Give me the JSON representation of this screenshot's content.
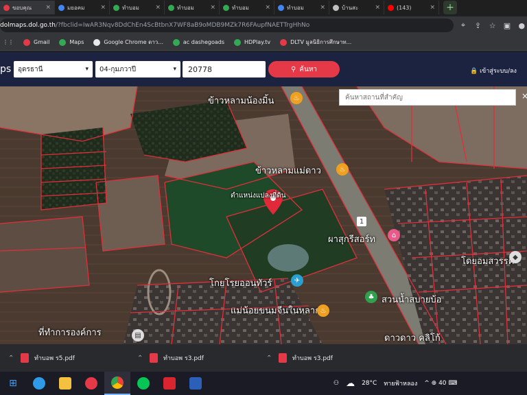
{
  "browser": {
    "tabs": [
      {
        "title": "ขอบคุณ",
        "favicon_color": "#e53948",
        "favicon_icon": "location-pin-icon"
      },
      {
        "title": "มยอคม",
        "favicon_color": "#4285f4",
        "favicon_icon": "google-drive-icon"
      },
      {
        "title": "ทำบอม",
        "favicon_color": "#34a853",
        "favicon_icon": "green-circle-icon"
      },
      {
        "title": "ทำบอม",
        "favicon_color": "#34a853",
        "favicon_icon": "green-circle-icon"
      },
      {
        "title": "ทำบอม",
        "favicon_color": "#34a853",
        "favicon_icon": "green-circle-icon"
      },
      {
        "title": "ทำบอม",
        "favicon_color": "#4285f4",
        "favicon_icon": "docs-icon"
      },
      {
        "title": "บ้านสะ",
        "favicon_color": "#c0c0c0",
        "favicon_icon": "globe-icon"
      },
      {
        "title": "(143)",
        "favicon_color": "#ff0000",
        "favicon_icon": "youtube-icon"
      }
    ],
    "tab_close": "×",
    "new_tab": "+",
    "url_host": "dolmaps.dol.go.th",
    "url_rest": "/?fbclid=IwAR3Nqv8DdChEn4ScBtbnX7WF8aB9oMDB9MZk7R6FAupfNAETTrgHhNo",
    "bookmarks": [
      {
        "label": "Gmail",
        "color": "#e53948"
      },
      {
        "label": "Maps",
        "color": "#34a853"
      },
      {
        "label": "Google Chrome ดาว...",
        "color": "#e8e8e8"
      },
      {
        "label": "ac dashegoads",
        "color": "#34a853"
      },
      {
        "label": "HDPlay.tv",
        "color": "#34a853"
      },
      {
        "label": "DLTV มูลนิธิการศึกษาท...",
        "color": "#e53948"
      }
    ]
  },
  "app": {
    "brand": "ps",
    "province": "อุดรธานี",
    "district": "04-กุมภวาปี",
    "parcel_number": "20778",
    "search_label": "ค้นหา",
    "login_label": "เข้าสู่ระบบ/ลง",
    "accent_color": "#e53948",
    "header_color": "#1c2340"
  },
  "map": {
    "poi_search_placeholder": "ค้นหาสถานที่สำคัญ",
    "close": "×",
    "labels": {
      "rice_top": "ข้าวหลามน้องมิ้น",
      "rice_mid": "ข้าวหลามแม่ดาว",
      "parcel_position": "ตำแหน่งแปลงที่ดิน",
      "phasuk": "ผาสุกรีสอร์ท",
      "toyrai": "โกยโรยออนทัวร์",
      "nong": "แม่น้อยขนมจีนในหลาก",
      "sawan": "สวนน้ำสบายบ้อ",
      "chon": "โดยอมสวรรค์",
      "office": "ที่ทำการองค์การ",
      "khaodao": "ดาวดาว คลิโก้"
    }
  },
  "downloads": [
    {
      "name": "ทำบอพ ร5.pdf"
    },
    {
      "name": "ทำบอพ ร3.pdf"
    },
    {
      "name": "ทำบอพ ร3.pdf"
    }
  ],
  "taskbar": {
    "weather": "28°C",
    "weather_desc": "ทายฟ้าหลอง",
    "tray_icons": "^ ⊕ 40 ⌨"
  }
}
